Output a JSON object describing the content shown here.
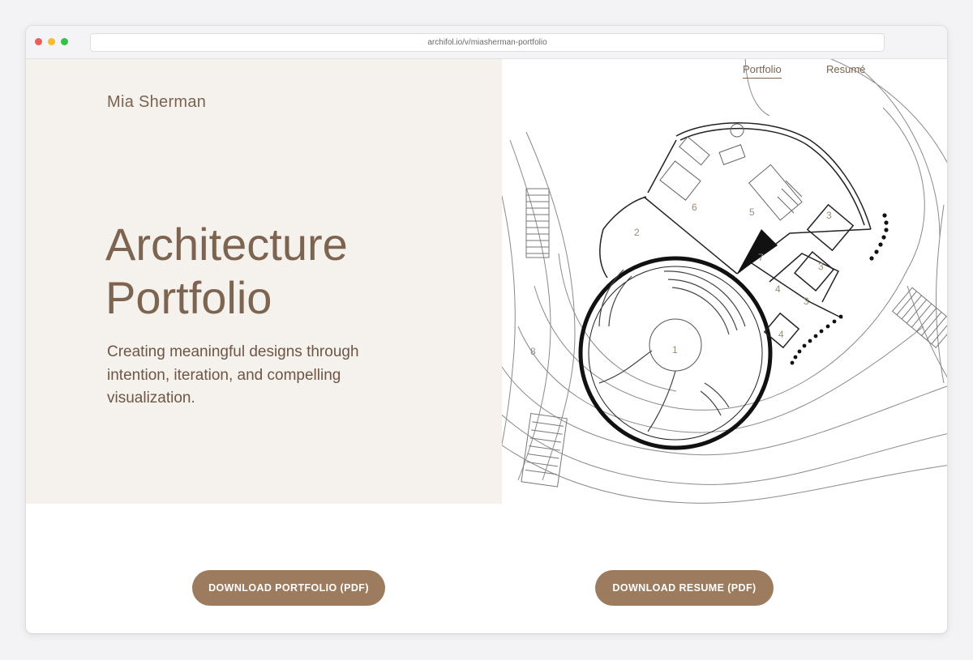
{
  "browser": {
    "url": "archifol.io/v/miasherman-portfolio"
  },
  "header": {
    "brand": "Mia Sherman",
    "nav": {
      "portfolio": "Portfolio",
      "resume": "Resumé"
    }
  },
  "hero": {
    "title_line1": "Architecture",
    "title_line2": "Portfolio",
    "tagline": "Creating meaningful designs through intention, iteration, and compelling visualization."
  },
  "plan_labels": {
    "room1": "1",
    "room2": "2",
    "room3a": "3",
    "room3b": "3",
    "room3c": "3",
    "room4a": "4",
    "room4b": "4",
    "room5": "5",
    "room6": "6",
    "room7": "7",
    "room8": "8"
  },
  "actions": {
    "download_portfolio": "DOWNLOAD PORTFOLIO (PDF)",
    "download_resume": "DOWNLOAD RESUME (PDF)"
  },
  "colors": {
    "accent": "#9c7b5e",
    "text_brown": "#7c6450",
    "hero_bg": "#f5f1ed"
  }
}
